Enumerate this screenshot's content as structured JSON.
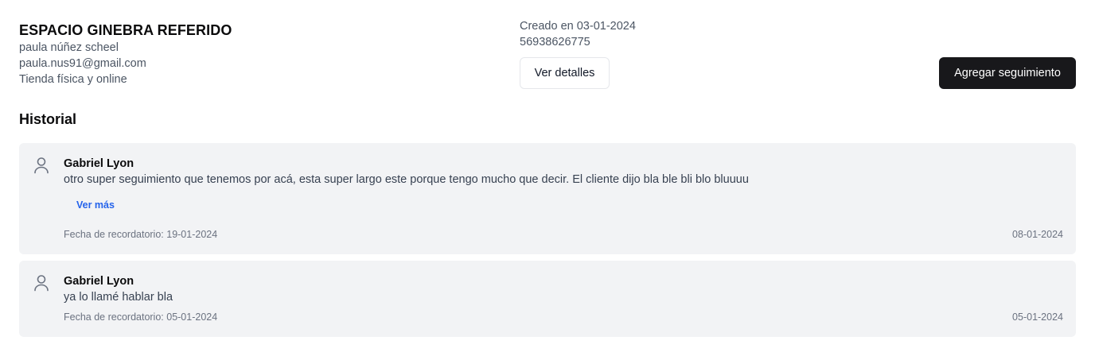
{
  "client": {
    "name": "ESPACIO GINEBRA REFERIDO",
    "contact_name": "paula núñez scheel",
    "email": "paula.nus91@gmail.com",
    "store_type": "Tienda física y online"
  },
  "meta": {
    "created": "Creado en 03-01-2024",
    "phone": "56938626775"
  },
  "actions": {
    "details_label": "Ver detalles",
    "add_followup_label": "Agregar seguimiento"
  },
  "history": {
    "title": "Historial",
    "entries": [
      {
        "author": "Gabriel Lyon",
        "comment": "otro super seguimiento que tenemos por acá, esta super largo este porque tengo mucho que decir. El cliente dijo bla ble bli blo bluuuu",
        "more_label": "Ver más",
        "reminder": "Fecha de recordatorio: 19-01-2024",
        "date": "08-01-2024",
        "icon": "user-icon"
      },
      {
        "author": "Gabriel Lyon",
        "comment": "ya lo llamé hablar bla",
        "reminder": "Fecha de recordatorio: 05-01-2024",
        "date": "05-01-2024",
        "icon": "user-icon"
      }
    ]
  }
}
